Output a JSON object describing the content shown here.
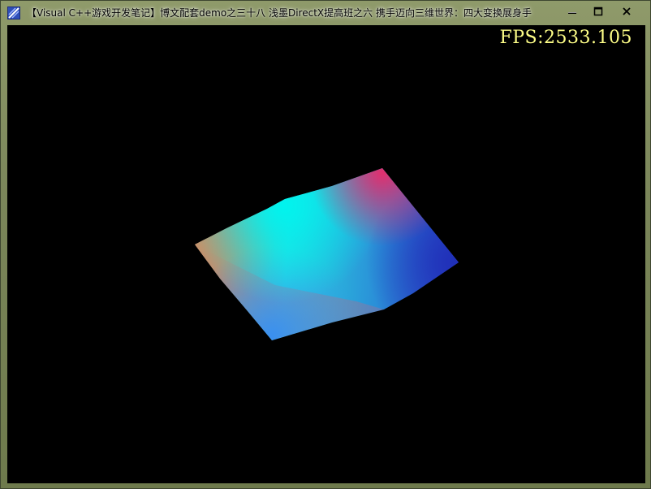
{
  "window": {
    "title": "【Visual C++游戏开发笔记】博文配套demo之三十八 浅墨DirectX提高班之六 携手迈向三维世界：四大变换展身手",
    "icon": "directx-app-icon",
    "controls": {
      "minimize_icon": "minimize-icon",
      "maximize_icon": "maximize-icon",
      "close_icon": "close-icon"
    }
  },
  "viewport": {
    "fps_label": "FPS:2533.105",
    "background_color": "#000000",
    "fps_color": "#ffff88",
    "mesh_colors": [
      "#00e8e8",
      "#d63a7a",
      "#2a3fc8",
      "#3a8ae8",
      "#c08a6a"
    ]
  }
}
